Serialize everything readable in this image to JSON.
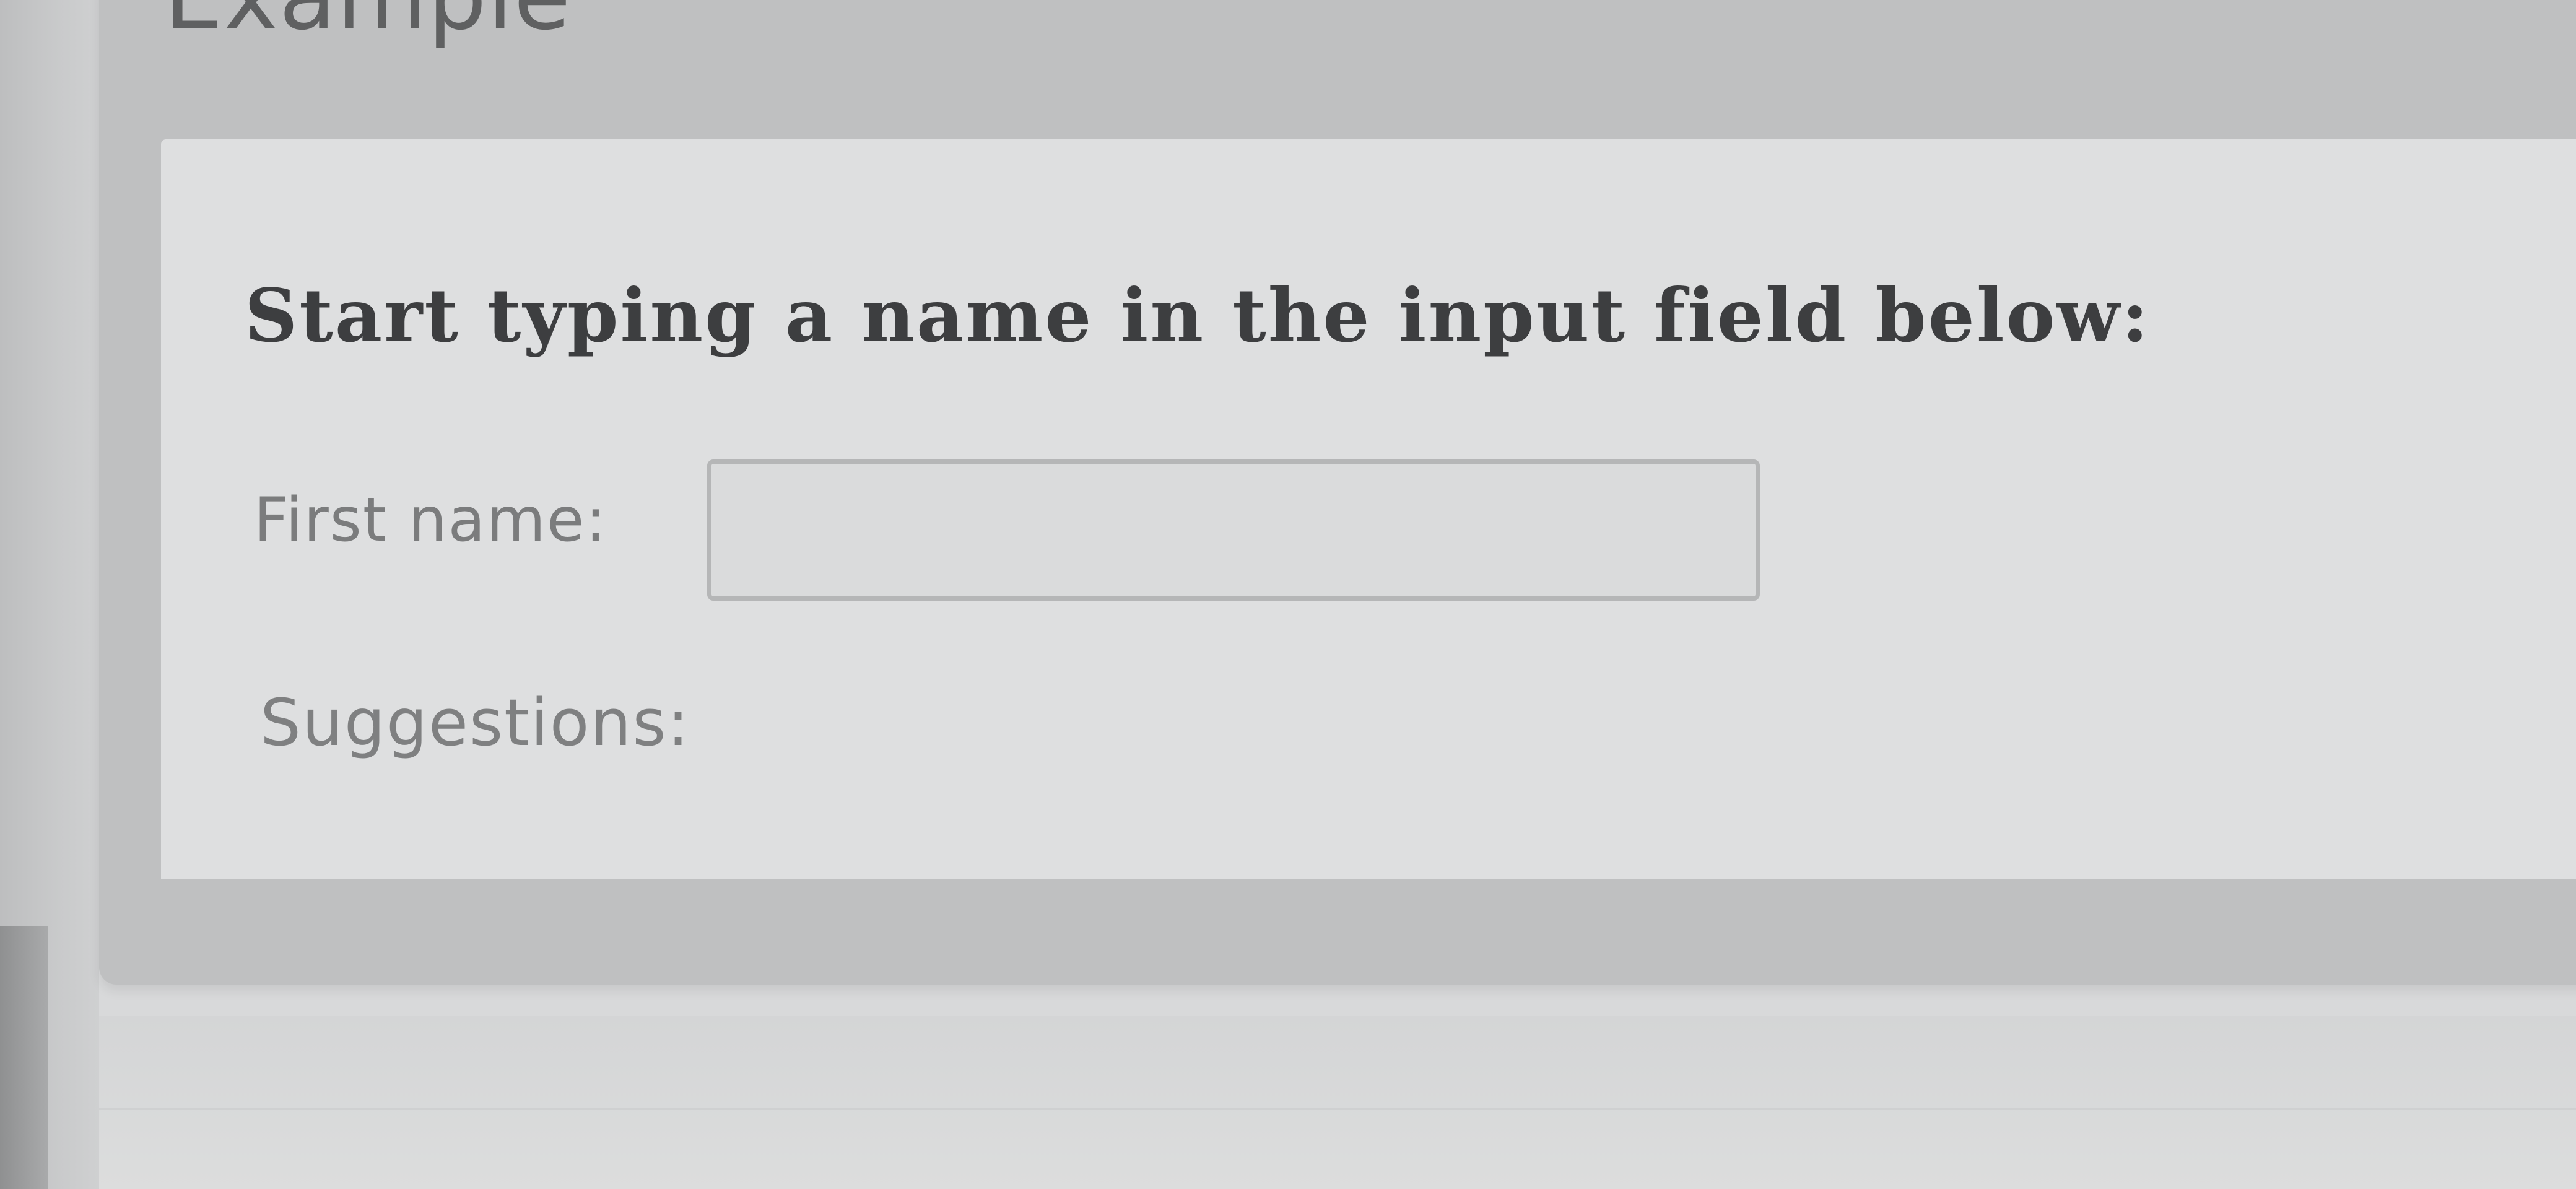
{
  "example": {
    "heading": "Example",
    "instruction": "Start typing a name in the input field below:",
    "first_name_label": "First name:",
    "first_name_value": "",
    "suggestions_label": "Suggestions:",
    "suggestions_value": ""
  }
}
